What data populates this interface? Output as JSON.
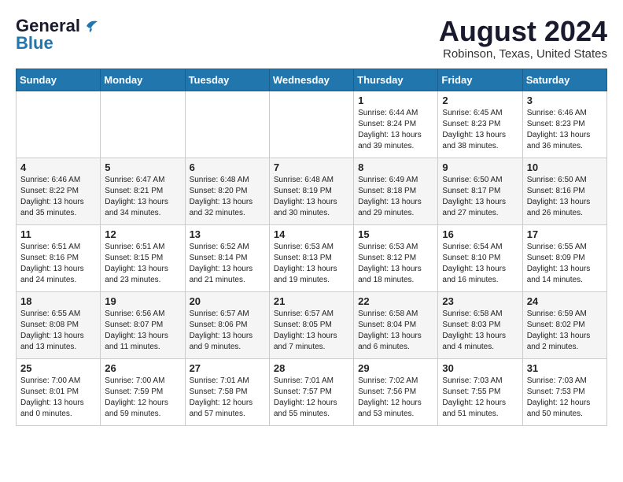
{
  "header": {
    "logo_line1": "General",
    "logo_line2": "Blue",
    "month_title": "August 2024",
    "location": "Robinson, Texas, United States"
  },
  "weekdays": [
    "Sunday",
    "Monday",
    "Tuesday",
    "Wednesday",
    "Thursday",
    "Friday",
    "Saturday"
  ],
  "weeks": [
    [
      {
        "day": "",
        "info": ""
      },
      {
        "day": "",
        "info": ""
      },
      {
        "day": "",
        "info": ""
      },
      {
        "day": "",
        "info": ""
      },
      {
        "day": "1",
        "info": "Sunrise: 6:44 AM\nSunset: 8:24 PM\nDaylight: 13 hours\nand 39 minutes."
      },
      {
        "day": "2",
        "info": "Sunrise: 6:45 AM\nSunset: 8:23 PM\nDaylight: 13 hours\nand 38 minutes."
      },
      {
        "day": "3",
        "info": "Sunrise: 6:46 AM\nSunset: 8:23 PM\nDaylight: 13 hours\nand 36 minutes."
      }
    ],
    [
      {
        "day": "4",
        "info": "Sunrise: 6:46 AM\nSunset: 8:22 PM\nDaylight: 13 hours\nand 35 minutes."
      },
      {
        "day": "5",
        "info": "Sunrise: 6:47 AM\nSunset: 8:21 PM\nDaylight: 13 hours\nand 34 minutes."
      },
      {
        "day": "6",
        "info": "Sunrise: 6:48 AM\nSunset: 8:20 PM\nDaylight: 13 hours\nand 32 minutes."
      },
      {
        "day": "7",
        "info": "Sunrise: 6:48 AM\nSunset: 8:19 PM\nDaylight: 13 hours\nand 30 minutes."
      },
      {
        "day": "8",
        "info": "Sunrise: 6:49 AM\nSunset: 8:18 PM\nDaylight: 13 hours\nand 29 minutes."
      },
      {
        "day": "9",
        "info": "Sunrise: 6:50 AM\nSunset: 8:17 PM\nDaylight: 13 hours\nand 27 minutes."
      },
      {
        "day": "10",
        "info": "Sunrise: 6:50 AM\nSunset: 8:16 PM\nDaylight: 13 hours\nand 26 minutes."
      }
    ],
    [
      {
        "day": "11",
        "info": "Sunrise: 6:51 AM\nSunset: 8:16 PM\nDaylight: 13 hours\nand 24 minutes."
      },
      {
        "day": "12",
        "info": "Sunrise: 6:51 AM\nSunset: 8:15 PM\nDaylight: 13 hours\nand 23 minutes."
      },
      {
        "day": "13",
        "info": "Sunrise: 6:52 AM\nSunset: 8:14 PM\nDaylight: 13 hours\nand 21 minutes."
      },
      {
        "day": "14",
        "info": "Sunrise: 6:53 AM\nSunset: 8:13 PM\nDaylight: 13 hours\nand 19 minutes."
      },
      {
        "day": "15",
        "info": "Sunrise: 6:53 AM\nSunset: 8:12 PM\nDaylight: 13 hours\nand 18 minutes."
      },
      {
        "day": "16",
        "info": "Sunrise: 6:54 AM\nSunset: 8:10 PM\nDaylight: 13 hours\nand 16 minutes."
      },
      {
        "day": "17",
        "info": "Sunrise: 6:55 AM\nSunset: 8:09 PM\nDaylight: 13 hours\nand 14 minutes."
      }
    ],
    [
      {
        "day": "18",
        "info": "Sunrise: 6:55 AM\nSunset: 8:08 PM\nDaylight: 13 hours\nand 13 minutes."
      },
      {
        "day": "19",
        "info": "Sunrise: 6:56 AM\nSunset: 8:07 PM\nDaylight: 13 hours\nand 11 minutes."
      },
      {
        "day": "20",
        "info": "Sunrise: 6:57 AM\nSunset: 8:06 PM\nDaylight: 13 hours\nand 9 minutes."
      },
      {
        "day": "21",
        "info": "Sunrise: 6:57 AM\nSunset: 8:05 PM\nDaylight: 13 hours\nand 7 minutes."
      },
      {
        "day": "22",
        "info": "Sunrise: 6:58 AM\nSunset: 8:04 PM\nDaylight: 13 hours\nand 6 minutes."
      },
      {
        "day": "23",
        "info": "Sunrise: 6:58 AM\nSunset: 8:03 PM\nDaylight: 13 hours\nand 4 minutes."
      },
      {
        "day": "24",
        "info": "Sunrise: 6:59 AM\nSunset: 8:02 PM\nDaylight: 13 hours\nand 2 minutes."
      }
    ],
    [
      {
        "day": "25",
        "info": "Sunrise: 7:00 AM\nSunset: 8:01 PM\nDaylight: 13 hours\nand 0 minutes."
      },
      {
        "day": "26",
        "info": "Sunrise: 7:00 AM\nSunset: 7:59 PM\nDaylight: 12 hours\nand 59 minutes."
      },
      {
        "day": "27",
        "info": "Sunrise: 7:01 AM\nSunset: 7:58 PM\nDaylight: 12 hours\nand 57 minutes."
      },
      {
        "day": "28",
        "info": "Sunrise: 7:01 AM\nSunset: 7:57 PM\nDaylight: 12 hours\nand 55 minutes."
      },
      {
        "day": "29",
        "info": "Sunrise: 7:02 AM\nSunset: 7:56 PM\nDaylight: 12 hours\nand 53 minutes."
      },
      {
        "day": "30",
        "info": "Sunrise: 7:03 AM\nSunset: 7:55 PM\nDaylight: 12 hours\nand 51 minutes."
      },
      {
        "day": "31",
        "info": "Sunrise: 7:03 AM\nSunset: 7:53 PM\nDaylight: 12 hours\nand 50 minutes."
      }
    ]
  ]
}
